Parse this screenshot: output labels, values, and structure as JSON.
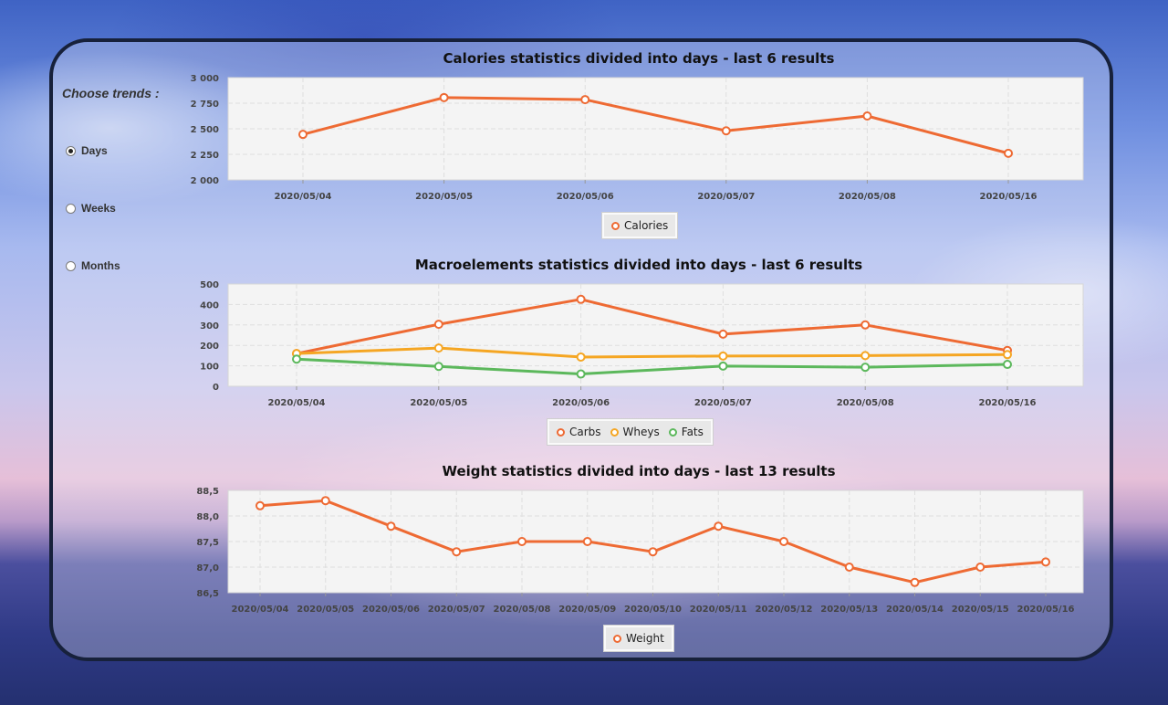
{
  "sidebar": {
    "title": "Choose trends :",
    "options": [
      {
        "label": "Days",
        "checked": true
      },
      {
        "label": "Weeks",
        "checked": false
      },
      {
        "label": "Months",
        "checked": false
      }
    ]
  },
  "colors": {
    "orange": "#ee6a33",
    "yellow": "#f5a623",
    "green": "#5cb85c"
  },
  "chart_data": [
    {
      "type": "line",
      "title": "Calories statistics divided into days - last 6 results",
      "categories": [
        "2020/05/04",
        "2020/05/05",
        "2020/05/06",
        "2020/05/07",
        "2020/05/08",
        "2020/05/16"
      ],
      "yticks": [
        "3 000",
        "2 750",
        "2 500",
        "2 250",
        "2 000"
      ],
      "ylim": [
        2000,
        3000
      ],
      "grid": true,
      "legend_placement": "bottom",
      "series": [
        {
          "name": "Calories",
          "color": "#ee6a33",
          "values": [
            2445,
            2805,
            2785,
            2480,
            2625,
            2260
          ]
        }
      ]
    },
    {
      "type": "line",
      "title": "Macroelements statistics divided into days - last 6 results",
      "categories": [
        "2020/05/04",
        "2020/05/05",
        "2020/05/06",
        "2020/05/07",
        "2020/05/08",
        "2020/05/16"
      ],
      "yticks": [
        "500",
        "400",
        "300",
        "200",
        "100",
        "0"
      ],
      "ylim": [
        0,
        500
      ],
      "grid": true,
      "legend_placement": "bottom",
      "series": [
        {
          "name": "Carbs",
          "color": "#ee6a33",
          "values": [
            160,
            303,
            425,
            255,
            300,
            175
          ]
        },
        {
          "name": "Wheys",
          "color": "#f5a623",
          "values": [
            160,
            187,
            143,
            148,
            150,
            155
          ]
        },
        {
          "name": "Fats",
          "color": "#5cb85c",
          "values": [
            133,
            97,
            60,
            99,
            93,
            107
          ]
        }
      ]
    },
    {
      "type": "line",
      "title": "Weight statistics divided into days - last 13 results",
      "categories": [
        "2020/05/04",
        "2020/05/05",
        "2020/05/06",
        "2020/05/07",
        "2020/05/08",
        "2020/05/09",
        "2020/05/10",
        "2020/05/11",
        "2020/05/12",
        "2020/05/13",
        "2020/05/14",
        "2020/05/15",
        "2020/05/16"
      ],
      "yticks": [
        "88,5",
        "88,0",
        "87,5",
        "87,0",
        "86,5"
      ],
      "ylim": [
        86.5,
        88.5
      ],
      "grid": true,
      "legend_placement": "bottom",
      "series": [
        {
          "name": "Weight",
          "color": "#ee6a33",
          "values": [
            88.2,
            88.3,
            87.8,
            87.3,
            87.5,
            87.5,
            87.3,
            87.8,
            87.5,
            87.0,
            86.7,
            87.0,
            87.1
          ]
        }
      ]
    }
  ]
}
